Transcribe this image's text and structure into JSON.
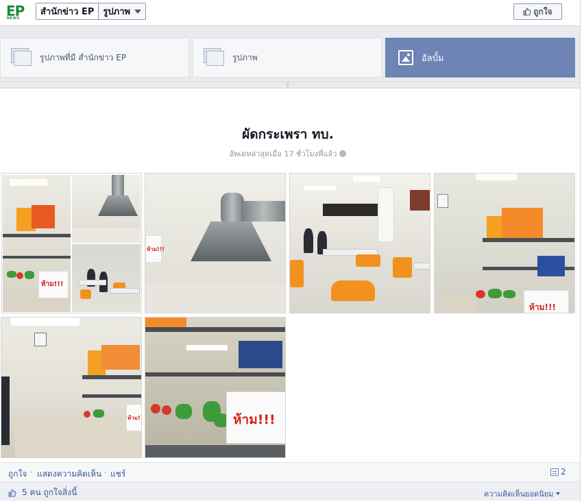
{
  "header": {
    "logo_text": "EP",
    "logo_sub": "NEWS",
    "page_name": "สำนักข่าว EP",
    "section_selector": "รูปภาพ",
    "like_button": "ถูกใจ"
  },
  "tabs": [
    {
      "label": "รูปภาพที่มี สำนักข่าว EP",
      "active": false
    },
    {
      "label": "รูปภาพ",
      "active": false
    },
    {
      "label": "อัลบั้ม",
      "active": true
    }
  ],
  "album": {
    "title": "ผัดกระเพรา ทบ.",
    "updated": "อัพเดทล่าสุดเมื่อ 17 ชั่วโมงที่แล้ว"
  },
  "photo_signs": {
    "forbid": "ห้าม!!!"
  },
  "actions": {
    "like": "ถูกใจ",
    "comment": "แสดงความคิดเห็น",
    "share": "แชร์",
    "separator": "·",
    "comment_count": "2"
  },
  "likes": {
    "text": "5 คน ถูกใจสิ่งนี้",
    "top_comments": "ความคิดเห็นยอดนิยม"
  },
  "colors": {
    "active_tab": "#6d84b4",
    "link": "#3b5998",
    "logo": "#1a8a3a"
  }
}
